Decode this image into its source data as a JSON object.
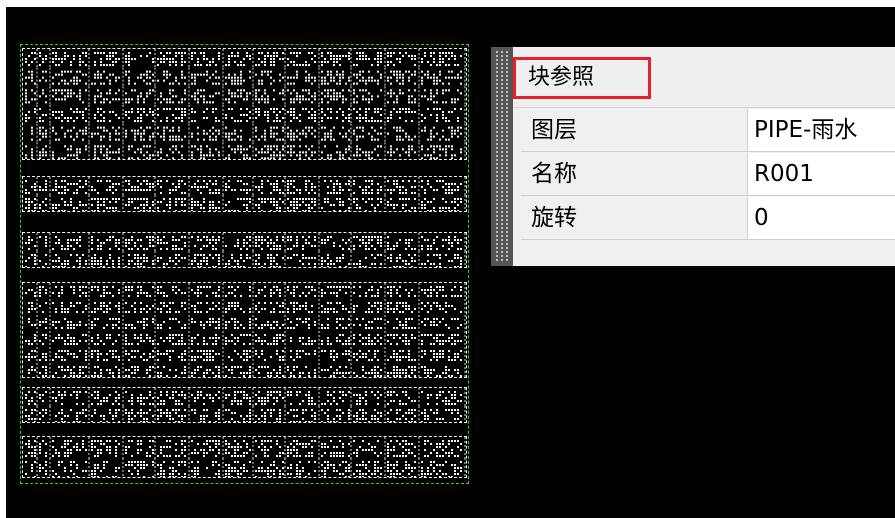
{
  "canvas": {
    "accent_selection": "#22d922",
    "background": "#000000",
    "selected_objects": [
      {
        "name": "table-block-1",
        "rows": 6
      },
      {
        "name": "table-block-2",
        "rows": 2
      },
      {
        "name": "table-block-3",
        "rows": 2
      },
      {
        "name": "table-block-4",
        "rows": 6
      },
      {
        "name": "table-block-5",
        "rows": 2
      },
      {
        "name": "table-block-6",
        "rows": 2
      }
    ]
  },
  "properties_panel": {
    "object_type": "块参照",
    "highlight_color": "#e8202a",
    "properties": [
      {
        "key": "图层",
        "value": "PIPE-雨水"
      },
      {
        "key": "名称",
        "value": "R001"
      },
      {
        "key": "旋转",
        "value": "0"
      }
    ]
  }
}
